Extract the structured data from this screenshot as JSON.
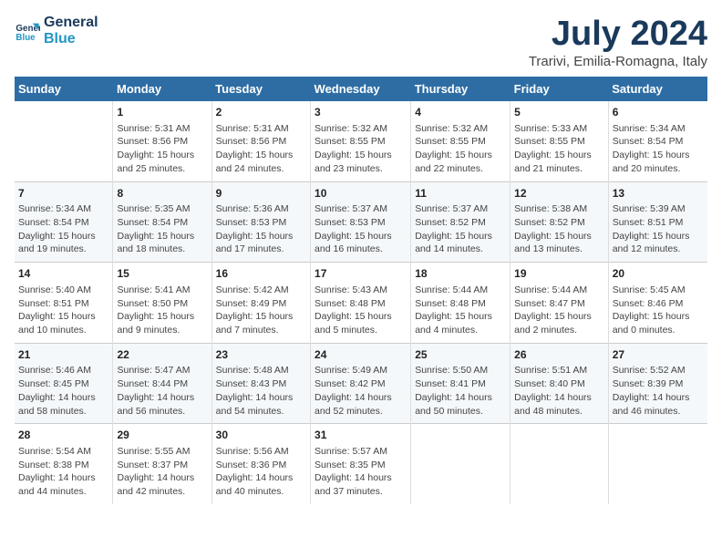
{
  "header": {
    "logo_line1": "General",
    "logo_line2": "Blue",
    "month_title": "July 2024",
    "location": "Trarivi, Emilia-Romagna, Italy"
  },
  "weekdays": [
    "Sunday",
    "Monday",
    "Tuesday",
    "Wednesday",
    "Thursday",
    "Friday",
    "Saturday"
  ],
  "weeks": [
    [
      {
        "day": "",
        "sunrise": "",
        "sunset": "",
        "daylight": ""
      },
      {
        "day": "1",
        "sunrise": "5:31 AM",
        "sunset": "8:56 PM",
        "daylight": "15 hours and 25 minutes."
      },
      {
        "day": "2",
        "sunrise": "5:31 AM",
        "sunset": "8:56 PM",
        "daylight": "15 hours and 24 minutes."
      },
      {
        "day": "3",
        "sunrise": "5:32 AM",
        "sunset": "8:55 PM",
        "daylight": "15 hours and 23 minutes."
      },
      {
        "day": "4",
        "sunrise": "5:32 AM",
        "sunset": "8:55 PM",
        "daylight": "15 hours and 22 minutes."
      },
      {
        "day": "5",
        "sunrise": "5:33 AM",
        "sunset": "8:55 PM",
        "daylight": "15 hours and 21 minutes."
      },
      {
        "day": "6",
        "sunrise": "5:34 AM",
        "sunset": "8:54 PM",
        "daylight": "15 hours and 20 minutes."
      }
    ],
    [
      {
        "day": "7",
        "sunrise": "5:34 AM",
        "sunset": "8:54 PM",
        "daylight": "15 hours and 19 minutes."
      },
      {
        "day": "8",
        "sunrise": "5:35 AM",
        "sunset": "8:54 PM",
        "daylight": "15 hours and 18 minutes."
      },
      {
        "day": "9",
        "sunrise": "5:36 AM",
        "sunset": "8:53 PM",
        "daylight": "15 hours and 17 minutes."
      },
      {
        "day": "10",
        "sunrise": "5:37 AM",
        "sunset": "8:53 PM",
        "daylight": "15 hours and 16 minutes."
      },
      {
        "day": "11",
        "sunrise": "5:37 AM",
        "sunset": "8:52 PM",
        "daylight": "15 hours and 14 minutes."
      },
      {
        "day": "12",
        "sunrise": "5:38 AM",
        "sunset": "8:52 PM",
        "daylight": "15 hours and 13 minutes."
      },
      {
        "day": "13",
        "sunrise": "5:39 AM",
        "sunset": "8:51 PM",
        "daylight": "15 hours and 12 minutes."
      }
    ],
    [
      {
        "day": "14",
        "sunrise": "5:40 AM",
        "sunset": "8:51 PM",
        "daylight": "15 hours and 10 minutes."
      },
      {
        "day": "15",
        "sunrise": "5:41 AM",
        "sunset": "8:50 PM",
        "daylight": "15 hours and 9 minutes."
      },
      {
        "day": "16",
        "sunrise": "5:42 AM",
        "sunset": "8:49 PM",
        "daylight": "15 hours and 7 minutes."
      },
      {
        "day": "17",
        "sunrise": "5:43 AM",
        "sunset": "8:48 PM",
        "daylight": "15 hours and 5 minutes."
      },
      {
        "day": "18",
        "sunrise": "5:44 AM",
        "sunset": "8:48 PM",
        "daylight": "15 hours and 4 minutes."
      },
      {
        "day": "19",
        "sunrise": "5:44 AM",
        "sunset": "8:47 PM",
        "daylight": "15 hours and 2 minutes."
      },
      {
        "day": "20",
        "sunrise": "5:45 AM",
        "sunset": "8:46 PM",
        "daylight": "15 hours and 0 minutes."
      }
    ],
    [
      {
        "day": "21",
        "sunrise": "5:46 AM",
        "sunset": "8:45 PM",
        "daylight": "14 hours and 58 minutes."
      },
      {
        "day": "22",
        "sunrise": "5:47 AM",
        "sunset": "8:44 PM",
        "daylight": "14 hours and 56 minutes."
      },
      {
        "day": "23",
        "sunrise": "5:48 AM",
        "sunset": "8:43 PM",
        "daylight": "14 hours and 54 minutes."
      },
      {
        "day": "24",
        "sunrise": "5:49 AM",
        "sunset": "8:42 PM",
        "daylight": "14 hours and 52 minutes."
      },
      {
        "day": "25",
        "sunrise": "5:50 AM",
        "sunset": "8:41 PM",
        "daylight": "14 hours and 50 minutes."
      },
      {
        "day": "26",
        "sunrise": "5:51 AM",
        "sunset": "8:40 PM",
        "daylight": "14 hours and 48 minutes."
      },
      {
        "day": "27",
        "sunrise": "5:52 AM",
        "sunset": "8:39 PM",
        "daylight": "14 hours and 46 minutes."
      }
    ],
    [
      {
        "day": "28",
        "sunrise": "5:54 AM",
        "sunset": "8:38 PM",
        "daylight": "14 hours and 44 minutes."
      },
      {
        "day": "29",
        "sunrise": "5:55 AM",
        "sunset": "8:37 PM",
        "daylight": "14 hours and 42 minutes."
      },
      {
        "day": "30",
        "sunrise": "5:56 AM",
        "sunset": "8:36 PM",
        "daylight": "14 hours and 40 minutes."
      },
      {
        "day": "31",
        "sunrise": "5:57 AM",
        "sunset": "8:35 PM",
        "daylight": "14 hours and 37 minutes."
      },
      {
        "day": "",
        "sunrise": "",
        "sunset": "",
        "daylight": ""
      },
      {
        "day": "",
        "sunrise": "",
        "sunset": "",
        "daylight": ""
      },
      {
        "day": "",
        "sunrise": "",
        "sunset": "",
        "daylight": ""
      }
    ]
  ]
}
